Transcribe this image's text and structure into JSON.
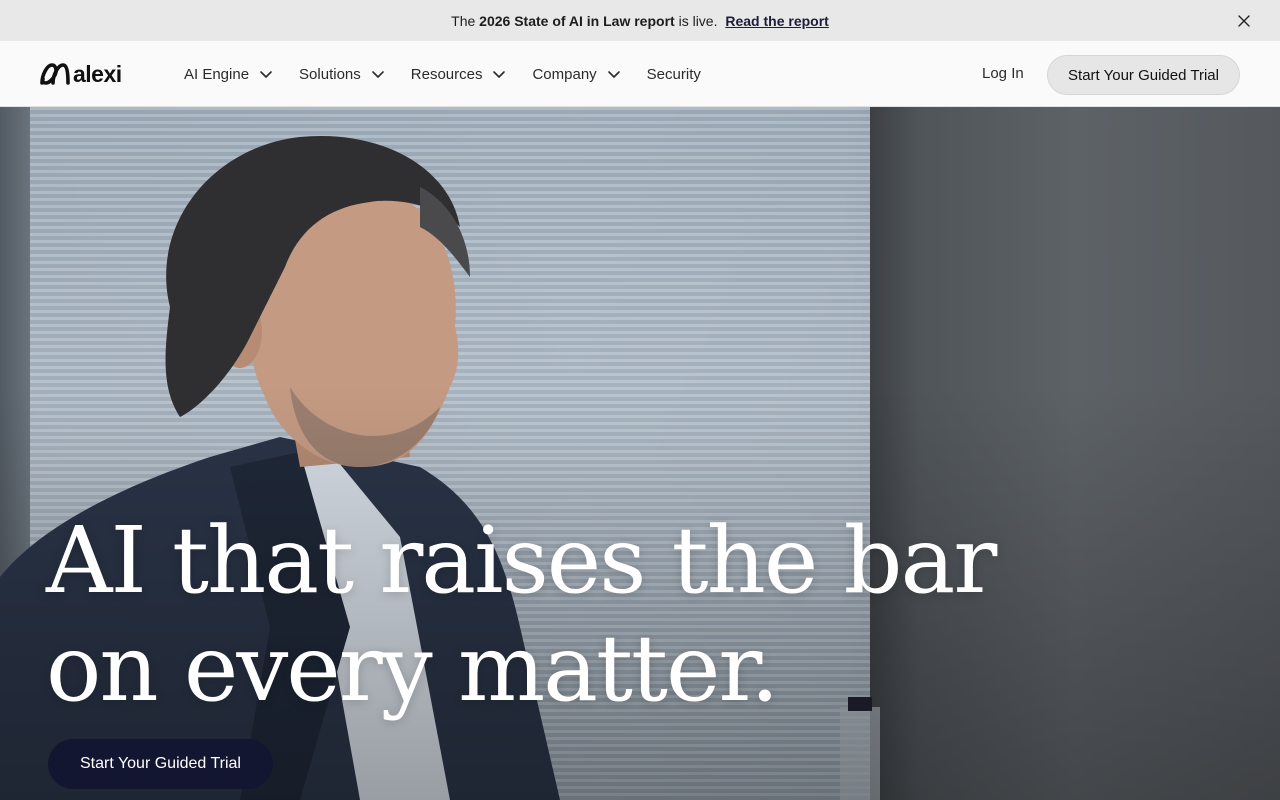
{
  "announcement": {
    "prefix": "The",
    "bold": "2026 State of AI in Law report",
    "suffix": "is live.",
    "link": "Read the report",
    "close_icon": "close-icon"
  },
  "nav": {
    "logo_text": "alexi",
    "logo_icon": "alexi-logo-icon",
    "items": [
      {
        "label": "AI Engine",
        "has_dropdown": true
      },
      {
        "label": "Solutions",
        "has_dropdown": true
      },
      {
        "label": "Resources",
        "has_dropdown": true
      },
      {
        "label": "Company",
        "has_dropdown": true
      },
      {
        "label": "Security",
        "has_dropdown": false
      }
    ],
    "login": "Log In",
    "cta": "Start Your Guided Trial"
  },
  "hero": {
    "headline_line1": "AI that raises the bar",
    "headline_line2": "on every matter.",
    "cta": "Start Your Guided Trial",
    "colors": {
      "cta_bg": "#131630",
      "announce_bg": "#e8e8e8",
      "nav_bg": "#fafafa"
    }
  }
}
